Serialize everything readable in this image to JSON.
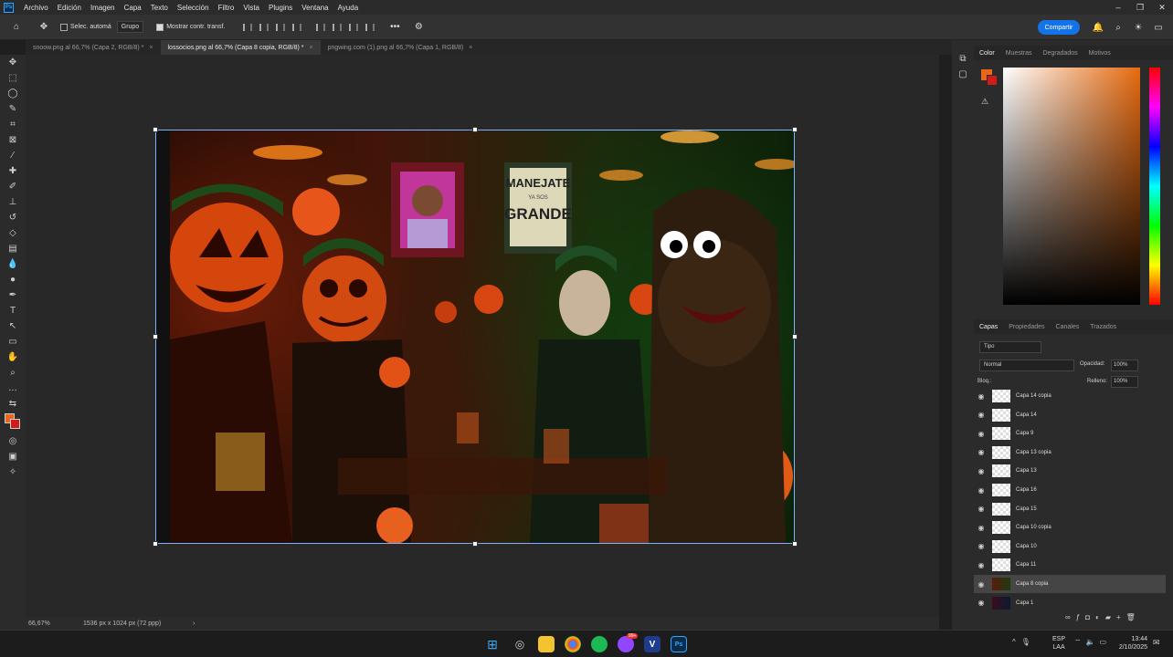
{
  "app": {
    "logo": "Ps"
  },
  "menu": [
    "Archivo",
    "Edición",
    "Imagen",
    "Capa",
    "Texto",
    "Selección",
    "Filtro",
    "Vista",
    "Plugins",
    "Ventana",
    "Ayuda"
  ],
  "options": {
    "auto_select_label": "Selec. automá",
    "auto_select_value": "Grupo",
    "show_transform_label": "Mostrar contr. transf.",
    "share_label": "Compartir"
  },
  "tabs": [
    {
      "label": "snoow.png al 66,7% (Capa 2, RGB/8) *",
      "active": false
    },
    {
      "label": "lossocios.png al 66,7% (Capa 8 copia, RGB/8) *",
      "active": true
    },
    {
      "label": "pngwing.com (1).png al 66,7% (Capa 1, RGB/8)",
      "active": false
    }
  ],
  "canvas": {
    "poster_line1": "MANEJATE",
    "poster_line2": "YA SOS",
    "poster_line3": "GRANDE"
  },
  "status": {
    "zoom": "66,67%",
    "doc_info": "1536 px x 1024 px (72 ppp)"
  },
  "color_panel": {
    "tabs": [
      "Color",
      "Muestras",
      "Degradados",
      "Motivos"
    ],
    "foreground": "#e8671c",
    "background": "#d11a1a"
  },
  "layers_panel": {
    "tabs": [
      "Capas",
      "Propiedades",
      "Canales",
      "Trazados"
    ],
    "filter": "Tipo",
    "blend_mode": "Normal",
    "opacity_label": "Opacidad:",
    "opacity_value": "100%",
    "lock_label": "Bloq.:",
    "fill_label": "Relleno:",
    "fill_value": "100%",
    "layers": [
      {
        "name": "Capa 14 copia",
        "selected": false
      },
      {
        "name": "Capa 14",
        "selected": false
      },
      {
        "name": "Capa 9",
        "selected": false
      },
      {
        "name": "Capa 13 copia",
        "selected": false
      },
      {
        "name": "Capa 13",
        "selected": false
      },
      {
        "name": "Capa 16",
        "selected": false
      },
      {
        "name": "Capa 15",
        "selected": false
      },
      {
        "name": "Capa 10 copia",
        "selected": false
      },
      {
        "name": "Capa 10",
        "selected": false
      },
      {
        "name": "Capa 11",
        "selected": false
      },
      {
        "name": "Capa 8 copia",
        "selected": true
      },
      {
        "name": "Capa 1",
        "selected": false
      }
    ]
  },
  "taskbar": {
    "lang1": "ESP",
    "lang2": "LAA",
    "time": "13:44",
    "date": "2/10/2025",
    "badge": "99+"
  }
}
